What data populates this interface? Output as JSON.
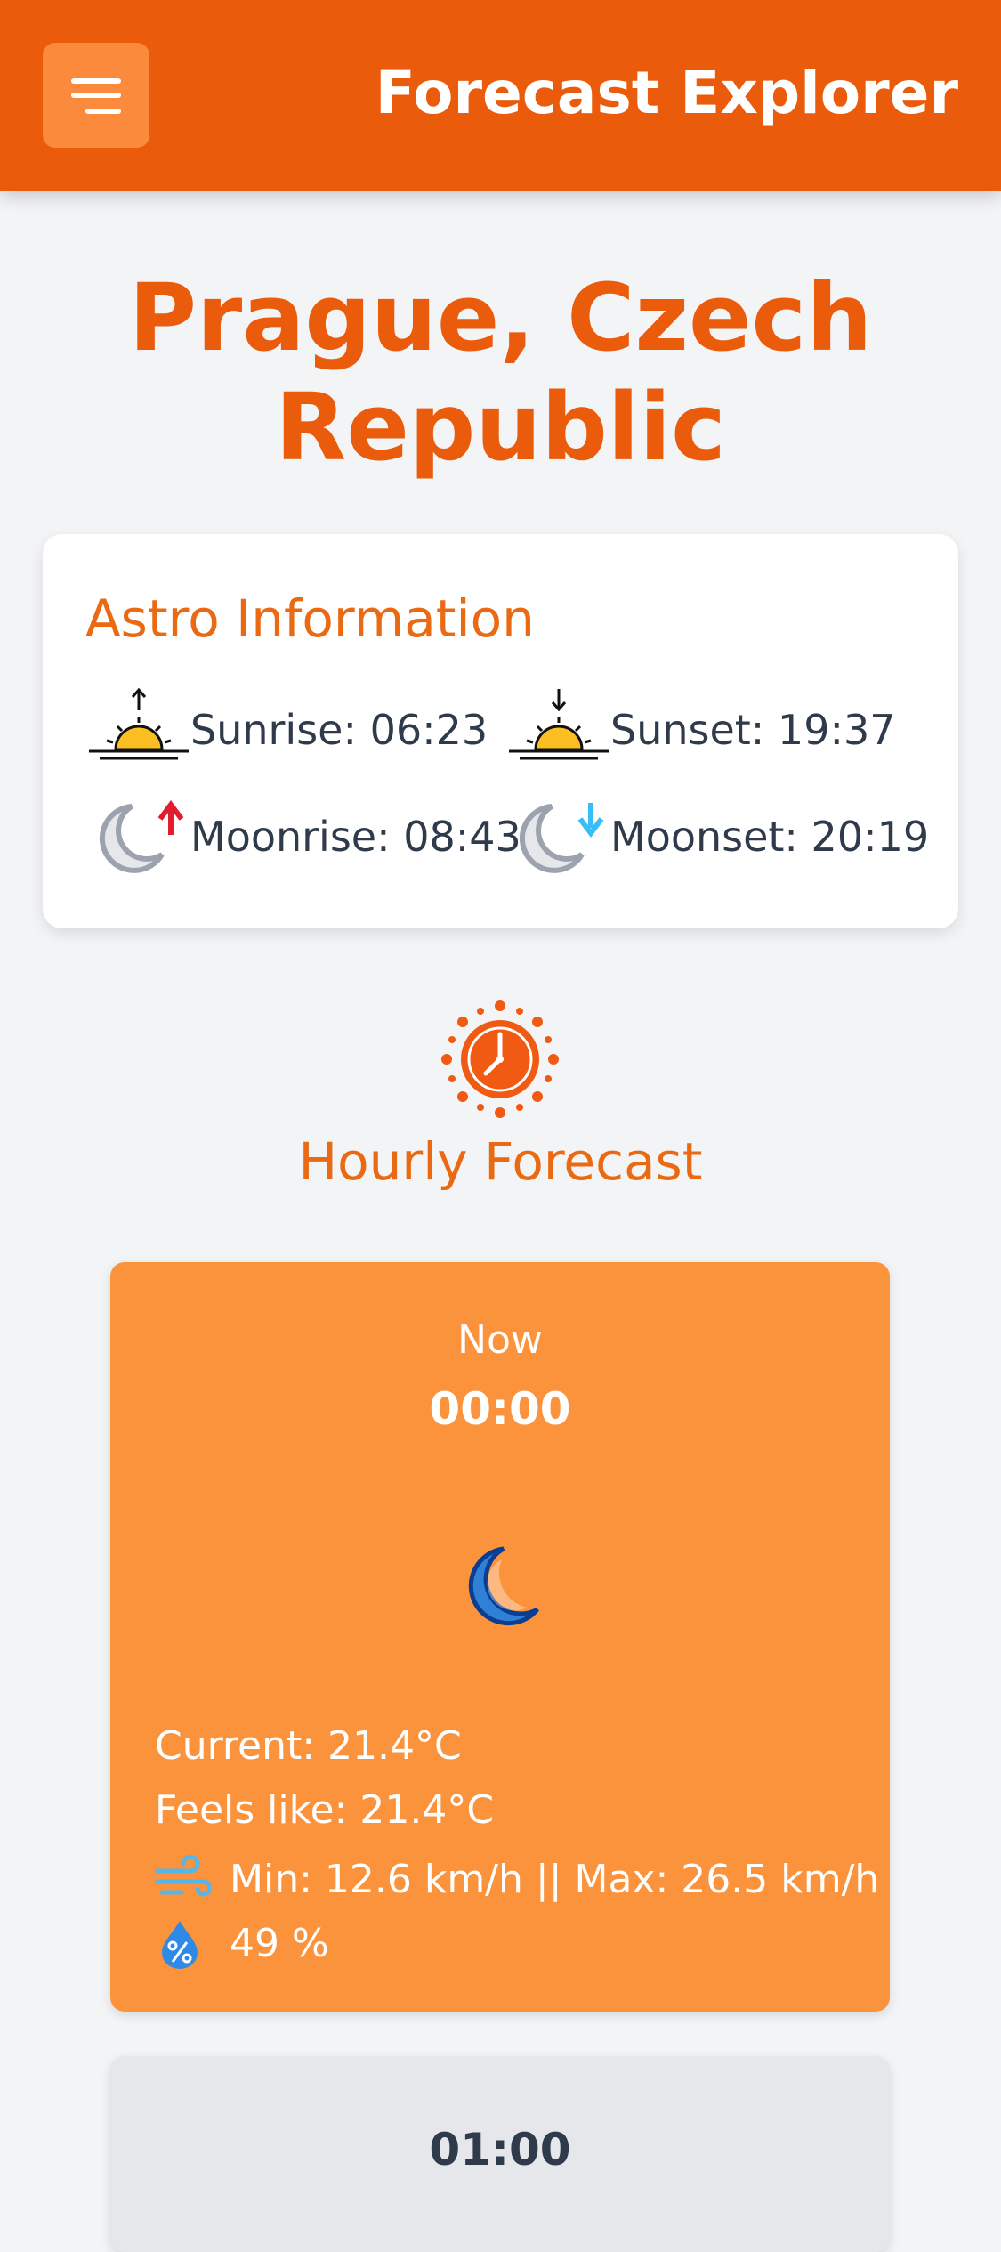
{
  "header": {
    "title": "Forecast Explorer",
    "menu_icon": "hamburger-menu-icon"
  },
  "location": {
    "city": "Prague, Czech Republic"
  },
  "astro": {
    "title": "Astro Information",
    "sunrise": "Sunrise: 06:23",
    "sunset": "Sunset: 19:37",
    "moonrise": "Moonrise: 08:43",
    "moonset": "Moonset: 20:19"
  },
  "hourly": {
    "title": "Hourly Forecast",
    "icon": "sun-clock-icon",
    "cards": [
      {
        "label": "Now",
        "time": "00:00",
        "icon": "crescent-moon-icon",
        "current": "Current: 21.4°C",
        "feels_like": "Feels like: 21.4°C",
        "wind": "Min: 12.6 km/h || Max: 26.5 km/h",
        "humidity": "49 %"
      },
      {
        "label": "",
        "time": "01:00"
      }
    ]
  },
  "colors": {
    "brand": "#ea5b0c",
    "accent": "#fb923c",
    "background": "#f3f4f6"
  }
}
